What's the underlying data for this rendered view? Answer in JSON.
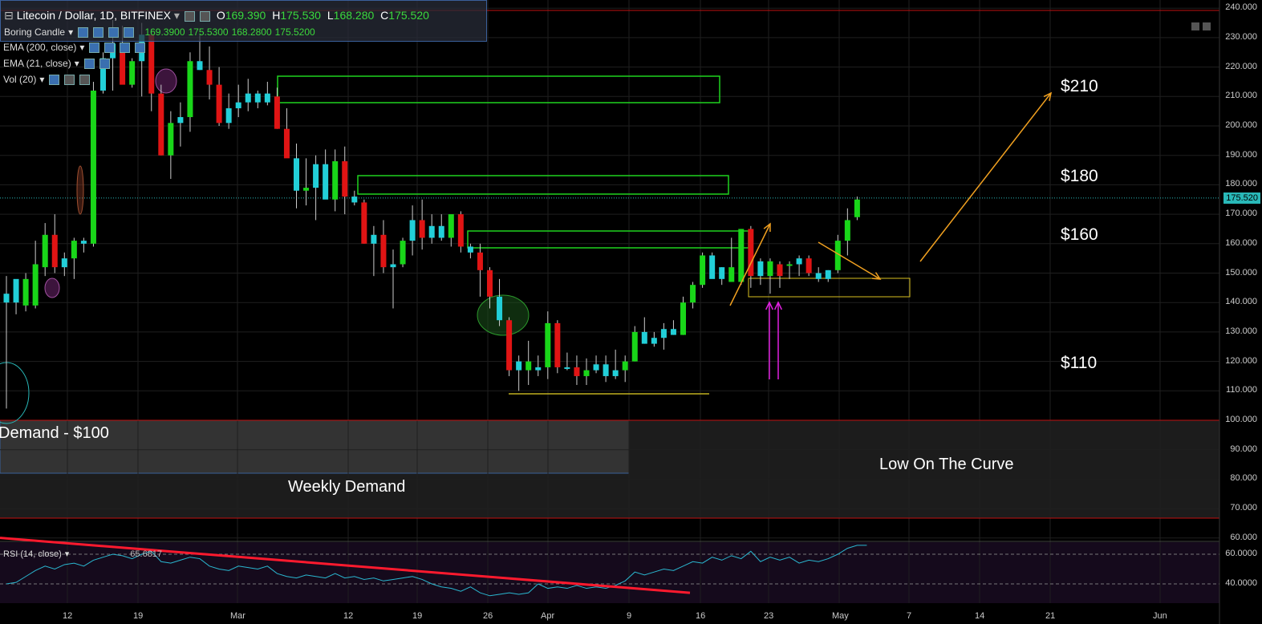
{
  "header": {
    "symbol": "Litecoin / Dollar, 1D, BITFINEX",
    "open_label": "O",
    "open": "169.390",
    "high_label": "H",
    "high": "175.530",
    "low_label": "L",
    "low": "168.280",
    "close_label": "C",
    "close": "175.520",
    "candle_type": "Boring Candle",
    "candle_values": [
      "169.3900",
      "175.5300",
      "168.2800",
      "175.5200"
    ],
    "ema200": "EMA (200, close)",
    "ema21": "EMA (21, close)",
    "vol": "Vol (20)",
    "rsi": "RSI (14, close)",
    "rsi_value": "65.6817"
  },
  "annotations": {
    "p210": "$210",
    "p180": "$180",
    "p160": "$160",
    "p110": "$110",
    "demand": "Demand - $100",
    "weekly": "Weekly Demand",
    "curve": "Low On The Curve"
  },
  "price_badge": "175.520",
  "colors": {
    "up": "#19d619",
    "down": "#e01414",
    "cyan": "#22cfd8",
    "box": "#1fd21f",
    "orange": "#f0a020",
    "magenta": "#e020e0"
  },
  "chart_data": [
    {
      "type": "candlestick",
      "title": "Litecoin / Dollar, 1D, BITFINEX",
      "yticks": [
        "240.000",
        "230.000",
        "220.000",
        "210.000",
        "200.000",
        "190.000",
        "180.000",
        "170.000",
        "160.000",
        "150.000",
        "140.000",
        "130.000",
        "120.000",
        "110.000",
        "100.000",
        "90.000",
        "80.000",
        "70.000",
        "60.000"
      ],
      "xticks": [
        "12",
        "19",
        "Mar",
        "12",
        "19",
        "26",
        "Apr",
        "9",
        "16",
        "23",
        "May",
        "7",
        "14",
        "21",
        "Jun"
      ],
      "ylim": [
        57,
        241
      ],
      "last_price": 175.52,
      "candles": [
        [
          143,
          149,
          104,
          140,
          "c"
        ],
        [
          140,
          145,
          136,
          148,
          "c"
        ],
        [
          148,
          150,
          137,
          139,
          "u"
        ],
        [
          139,
          161,
          138,
          153,
          "u"
        ],
        [
          152,
          167,
          149,
          163,
          "u"
        ],
        [
          163,
          170,
          150,
          152,
          "d"
        ],
        [
          152,
          157,
          149,
          155,
          "c"
        ],
        [
          155,
          162,
          148,
          161,
          "u"
        ],
        [
          160,
          162,
          157,
          161,
          "c"
        ],
        [
          160,
          215,
          159,
          212,
          "u"
        ],
        [
          212,
          225,
          211,
          223,
          "c"
        ],
        [
          223,
          236,
          212,
          228,
          "c"
        ],
        [
          228,
          234,
          215,
          214,
          "d"
        ],
        [
          214,
          223,
          213,
          222,
          "u"
        ],
        [
          222,
          235,
          210,
          231,
          "c"
        ],
        [
          231,
          233,
          205,
          211,
          "d"
        ],
        [
          211,
          214,
          190,
          190,
          "d"
        ],
        [
          190,
          205,
          182,
          201,
          "u"
        ],
        [
          201,
          208,
          193,
          203,
          "c"
        ],
        [
          203,
          225,
          198,
          222,
          "u"
        ],
        [
          222,
          231,
          219,
          219,
          "c"
        ],
        [
          219,
          227,
          209,
          214,
          "d"
        ],
        [
          214,
          220,
          200,
          201,
          "d"
        ],
        [
          201,
          211,
          199,
          206,
          "c"
        ],
        [
          206,
          214,
          203,
          208,
          "c"
        ],
        [
          208,
          216,
          205,
          211,
          "c"
        ],
        [
          211,
          212,
          206,
          208,
          "c"
        ],
        [
          208,
          215,
          207,
          211,
          "c"
        ],
        [
          210,
          213,
          199,
          199,
          "d"
        ],
        [
          199,
          206,
          190,
          189,
          "d"
        ],
        [
          189,
          194,
          172,
          178,
          "c"
        ],
        [
          178,
          189,
          173,
          179,
          "u"
        ],
        [
          179,
          190,
          168,
          187,
          "c"
        ],
        [
          187,
          192,
          176,
          175,
          "c"
        ],
        [
          175,
          192,
          171,
          188,
          "u"
        ],
        [
          188,
          193,
          170,
          176,
          "d"
        ],
        [
          176,
          178,
          173,
          174,
          "c"
        ],
        [
          174,
          175,
          160,
          160,
          "d"
        ],
        [
          160,
          166,
          149,
          163,
          "c"
        ],
        [
          163,
          168,
          150,
          152,
          "d"
        ],
        [
          152,
          158,
          138,
          153,
          "c"
        ],
        [
          153,
          162,
          152,
          161,
          "u"
        ],
        [
          161,
          173,
          156,
          168,
          "c"
        ],
        [
          168,
          175,
          158,
          162,
          "d"
        ],
        [
          162,
          170,
          160,
          166,
          "c"
        ],
        [
          166,
          170,
          161,
          162,
          "c"
        ],
        [
          162,
          168,
          159,
          170,
          "u"
        ],
        [
          170,
          171,
          157,
          159,
          "d"
        ],
        [
          159,
          160,
          155,
          157,
          "c"
        ],
        [
          157,
          160,
          142,
          151,
          "d"
        ],
        [
          151,
          152,
          138,
          142,
          "d"
        ],
        [
          142,
          148,
          132,
          134,
          "c"
        ],
        [
          134,
          135,
          115,
          117,
          "d"
        ],
        [
          117,
          122,
          110,
          120,
          "c"
        ],
        [
          120,
          127,
          112,
          117,
          "u"
        ],
        [
          117,
          122,
          115,
          118,
          "c"
        ],
        [
          118,
          137,
          114,
          133,
          "u"
        ],
        [
          133,
          134,
          116,
          118,
          "d"
        ],
        [
          118,
          123,
          117,
          118,
          "c"
        ],
        [
          118,
          122,
          112,
          115,
          "d"
        ],
        [
          115,
          121,
          112,
          117,
          "u"
        ],
        [
          117,
          122,
          116,
          119,
          "c"
        ],
        [
          119,
          122,
          113,
          115,
          "c"
        ],
        [
          115,
          124,
          114,
          117,
          "c"
        ],
        [
          117,
          122,
          113,
          120,
          "u"
        ],
        [
          120,
          132,
          120,
          130,
          "u"
        ],
        [
          130,
          135,
          126,
          126,
          "c"
        ],
        [
          126,
          130,
          125,
          128,
          "c"
        ],
        [
          128,
          133,
          124,
          131,
          "c"
        ],
        [
          131,
          134,
          129,
          129,
          "c"
        ],
        [
          129,
          142,
          129,
          140,
          "u"
        ],
        [
          140,
          147,
          138,
          146,
          "u"
        ],
        [
          146,
          157,
          145,
          156,
          "u"
        ],
        [
          156,
          157,
          149,
          148,
          "c"
        ],
        [
          148,
          152,
          146,
          152,
          "c"
        ],
        [
          152,
          162,
          148,
          147,
          "u"
        ],
        [
          147,
          165,
          146,
          165,
          "u"
        ],
        [
          165,
          166,
          145,
          149,
          "d"
        ],
        [
          149,
          155,
          146,
          154,
          "c"
        ],
        [
          154,
          155,
          143,
          149,
          "u"
        ],
        [
          149,
          154,
          145,
          153,
          "d"
        ],
        [
          153,
          154,
          148,
          153,
          "u"
        ],
        [
          153,
          156,
          149,
          155,
          "c"
        ],
        [
          155,
          156,
          149,
          150,
          "d"
        ],
        [
          150,
          152,
          147,
          148,
          "c"
        ],
        [
          148,
          151,
          147,
          151,
          "c"
        ],
        [
          151,
          163,
          150,
          161,
          "u"
        ],
        [
          161,
          172,
          156,
          168,
          "u"
        ],
        [
          169,
          176,
          168,
          175,
          "u"
        ]
      ],
      "rsi": [
        40,
        41,
        45,
        49,
        52,
        50,
        53,
        54,
        52,
        56,
        58,
        60,
        59,
        57,
        60,
        62,
        55,
        54,
        56,
        58,
        57,
        52,
        50,
        49,
        52,
        51,
        50,
        52,
        47,
        45,
        44,
        46,
        45,
        44,
        47,
        44,
        45,
        43,
        44,
        42,
        43,
        44,
        45,
        43,
        40,
        38,
        37,
        35,
        38,
        34,
        32,
        33,
        34,
        33,
        34,
        40,
        37,
        38,
        37,
        39,
        37,
        38,
        37,
        39,
        42,
        48,
        46,
        48,
        50,
        49,
        52,
        55,
        54,
        58,
        56,
        59,
        57,
        62,
        55,
        58,
        56,
        58,
        54,
        56,
        55,
        57,
        60,
        64,
        66,
        66
      ]
    }
  ]
}
